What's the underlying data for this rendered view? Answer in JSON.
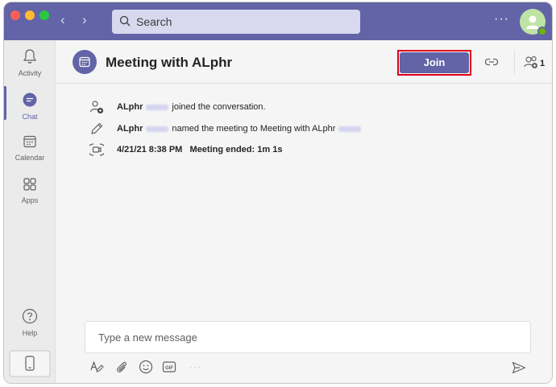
{
  "titlebar": {
    "search_placeholder": "Search",
    "more_label": "···"
  },
  "rail": {
    "items": [
      {
        "label": "Activity",
        "icon": "bell-icon"
      },
      {
        "label": "Chat",
        "icon": "chat-icon"
      },
      {
        "label": "Calendar",
        "icon": "calendar-icon"
      },
      {
        "label": "Apps",
        "icon": "apps-icon"
      }
    ],
    "help_label": "Help"
  },
  "header": {
    "title": "Meeting with ALphr",
    "join_label": "Join",
    "participant_count": "1"
  },
  "events": [
    {
      "name": "ALphr",
      "text": "joined the conversation.",
      "icon": "person-add-icon"
    },
    {
      "name": "ALphr",
      "text": "named the meeting to Meeting with ALphr",
      "icon": "pencil-icon"
    },
    {
      "time": "4/21/21 8:38 PM",
      "text": "Meeting ended:",
      "duration": "1m 1s",
      "icon": "video-call-icon"
    }
  ],
  "compose": {
    "placeholder": "Type a new message"
  },
  "colors": {
    "brand": "#6264a7",
    "highlight": "#e0001b"
  }
}
